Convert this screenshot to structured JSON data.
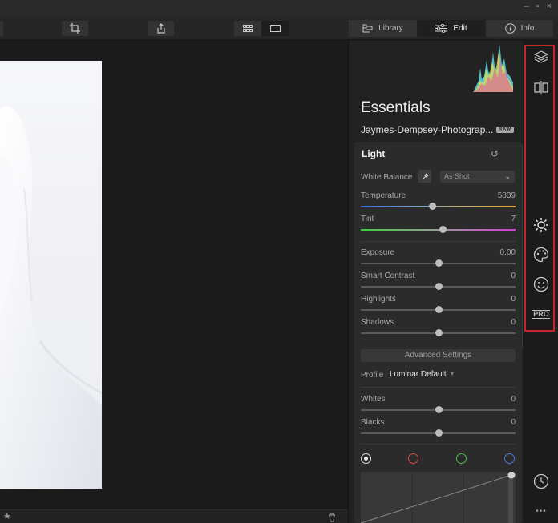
{
  "window": {
    "minimize": "–",
    "restore": "▫",
    "close": "×"
  },
  "toolbar": {
    "tabs": [
      {
        "label": "Library",
        "icon": "library-icon"
      },
      {
        "label": "Edit",
        "icon": "sliders-icon"
      },
      {
        "label": "Info",
        "icon": "info-icon"
      }
    ],
    "active_tab": "Edit"
  },
  "panel": {
    "title": "Essentials",
    "filename": "Jaymes-Dempsey-Photograp...",
    "badge": "RAW",
    "section": {
      "title": "Light",
      "white_balance": {
        "label": "White Balance",
        "value": "As Shot"
      },
      "sliders_top": [
        {
          "label": "Temperature",
          "value": "5839",
          "position": 0.46
        },
        {
          "label": "Tint",
          "value": "7",
          "position": 0.53
        }
      ],
      "sliders_mid": [
        {
          "label": "Exposure",
          "value": "0.00",
          "position": 0.5
        },
        {
          "label": "Smart Contrast",
          "value": "0",
          "position": 0.5
        },
        {
          "label": "Highlights",
          "value": "0",
          "position": 0.5
        },
        {
          "label": "Shadows",
          "value": "0",
          "position": 0.5
        }
      ],
      "advanced_label": "Advanced Settings",
      "profile": {
        "label": "Profile",
        "value": "Luminar Default"
      },
      "sliders_bottom": [
        {
          "label": "Whites",
          "value": "0",
          "position": 0.5
        },
        {
          "label": "Blacks",
          "value": "0",
          "position": 0.5
        }
      ],
      "channel_colors": [
        "#dddddd",
        "#e04848",
        "#4cc14c",
        "#4a7be0"
      ]
    }
  },
  "strip": {
    "icons": [
      "layers-icon",
      "compare-icon",
      "sun-icon",
      "palette-icon",
      "face-icon",
      "pro-icon",
      "history-icon",
      "more-icon"
    ],
    "pro_label": "PRO",
    "more_label": "•••"
  },
  "colors": {
    "highlight": "#c8242b",
    "panel": "#222222",
    "card": "#2b2b2b"
  }
}
